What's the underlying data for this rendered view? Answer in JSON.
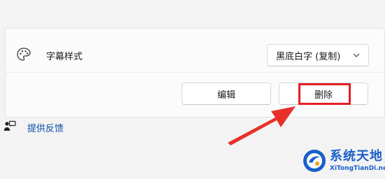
{
  "setting": {
    "label": "字幕样式",
    "icon": "palette-icon",
    "dropdown_value": "黑底白字 (复制)"
  },
  "buttons": {
    "edit_label": "编辑",
    "delete_label": "删除"
  },
  "feedback": {
    "label": "提供反馈",
    "icon": "feedback-icon"
  },
  "annotation": {
    "highlight_color": "#e21f24",
    "arrow_color": "#e8302a"
  },
  "watermark": {
    "title": "系统天地",
    "url": "XiTongTianDi.net"
  }
}
